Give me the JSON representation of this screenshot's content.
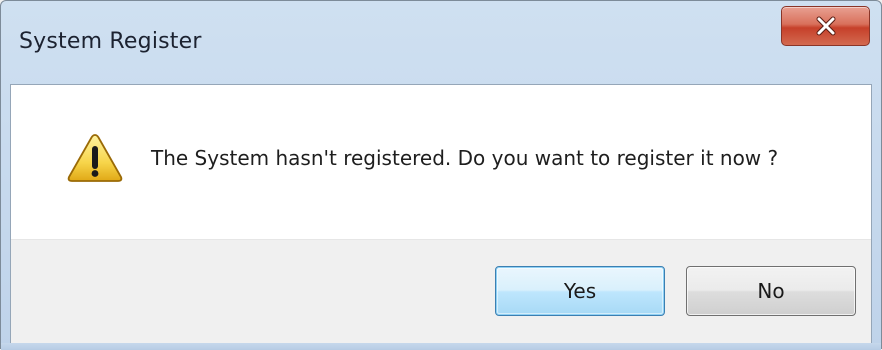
{
  "window": {
    "title": "System Register"
  },
  "dialog": {
    "icon": "warning-icon",
    "message": "The System hasn't registered. Do you want to register it now ?"
  },
  "buttons": {
    "yes_label": "Yes",
    "no_label": "No",
    "default": "yes"
  },
  "colors": {
    "close_button": "#c6402a",
    "default_button_border": "#3c7fb1",
    "warning_fill": "#f7d54a"
  }
}
